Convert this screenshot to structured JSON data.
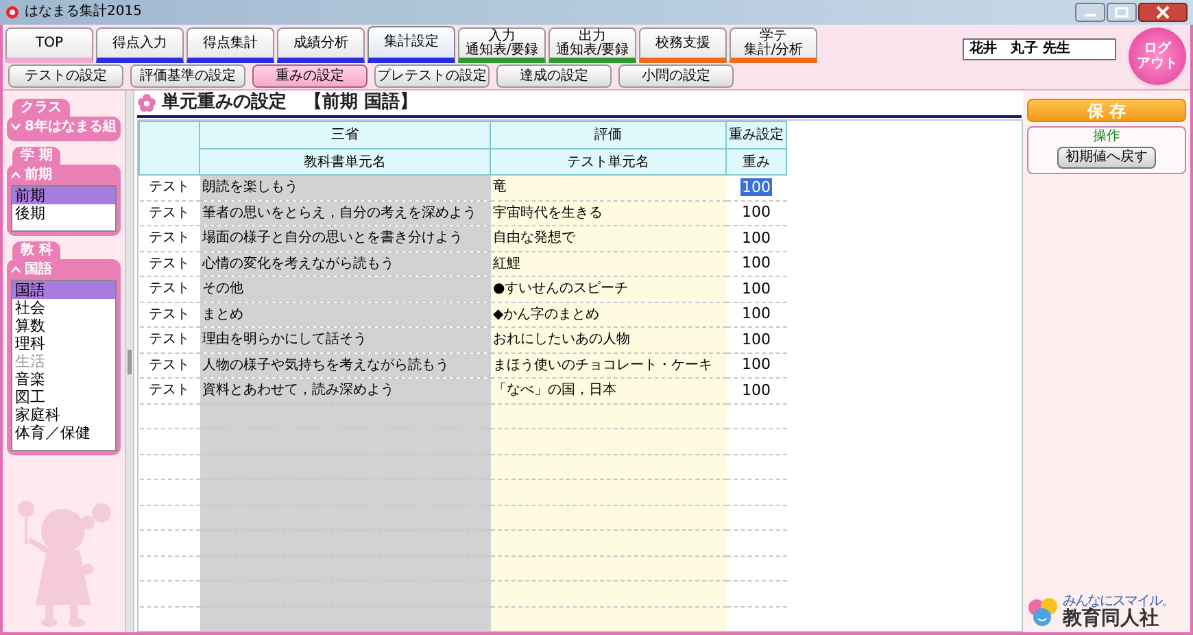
{
  "window": {
    "title": "はなまる集計2015"
  },
  "main_tabs": [
    {
      "label": "TOP",
      "color": "#f7a8cf",
      "selected": false
    },
    {
      "label": "得点入力",
      "color": "#2a2ae0",
      "selected": false
    },
    {
      "label": "得点集計",
      "color": "#2a2ae0",
      "selected": false
    },
    {
      "label": "成績分析",
      "color": "#2a2ae0",
      "selected": false
    },
    {
      "label": "集計設定",
      "color": "#2a2ae0",
      "selected": true
    },
    {
      "lines": [
        "入力",
        "通知表/要録"
      ],
      "color": "#2e9a2e",
      "selected": false
    },
    {
      "lines": [
        "出力",
        "通知表/要録"
      ],
      "color": "#2e9a2e",
      "selected": false
    },
    {
      "label": "校務支援",
      "color": "#f26a1b",
      "selected": false
    },
    {
      "lines": [
        "学テ",
        "集計/分析"
      ],
      "color": "#f26a1b",
      "selected": false
    }
  ],
  "user_name": "花井　丸子 先生",
  "logout_button": [
    "ログ",
    "アウト"
  ],
  "sub_tabs": [
    {
      "label": "テストの設定",
      "selected": false
    },
    {
      "label": "評価基準の設定",
      "selected": false
    },
    {
      "label": "重みの設定",
      "selected": true
    },
    {
      "label": "プレテストの設定",
      "selected": false
    },
    {
      "label": "達成の設定",
      "selected": false
    },
    {
      "label": "小問の設定",
      "selected": false
    }
  ],
  "sidebar": {
    "groups": [
      {
        "title": "クラス",
        "dropdown": "8年はなまる組",
        "expanded": false
      },
      {
        "title": "学 期",
        "dropdown": "前期",
        "expanded": true,
        "items": [
          {
            "label": "前期",
            "selected": true,
            "disabled": false
          },
          {
            "label": "後期",
            "selected": false,
            "disabled": false
          }
        ]
      },
      {
        "title": "教 科",
        "dropdown": "国語",
        "expanded": true,
        "items": [
          {
            "label": "国語",
            "selected": true,
            "disabled": false
          },
          {
            "label": "社会",
            "selected": false,
            "disabled": false
          },
          {
            "label": "算数",
            "selected": false,
            "disabled": false
          },
          {
            "label": "理科",
            "selected": false,
            "disabled": false
          },
          {
            "label": "生活",
            "selected": false,
            "disabled": true
          },
          {
            "label": "音楽",
            "selected": false,
            "disabled": false
          },
          {
            "label": "図工",
            "selected": false,
            "disabled": false
          },
          {
            "label": "家庭科",
            "selected": false,
            "disabled": false
          },
          {
            "label": "体育／保健",
            "selected": false,
            "disabled": false
          }
        ]
      }
    ]
  },
  "page_title": "単元重みの設定　【前期 国語】",
  "table": {
    "columns": [
      {
        "top": "三省",
        "bottom": "教科書単元名"
      },
      {
        "top": "評価",
        "bottom": "テスト単元名"
      },
      {
        "top": "重み設定",
        "bottom": "重み"
      }
    ],
    "rows": [
      {
        "type": "テスト",
        "textbook_unit": "朗読を楽しもう",
        "test_unit": "竜",
        "weight": "100",
        "selected": true
      },
      {
        "type": "テスト",
        "textbook_unit": "筆者の思いをとらえ，自分の考えを深めよう",
        "test_unit": "宇宙時代を生きる",
        "weight": "100",
        "selected": false
      },
      {
        "type": "テスト",
        "textbook_unit": "場面の様子と自分の思いとを書き分けよう",
        "test_unit": "自由な発想で",
        "weight": "100",
        "selected": false
      },
      {
        "type": "テスト",
        "textbook_unit": "心情の変化を考えながら読もう",
        "test_unit": "紅鯉",
        "weight": "100",
        "selected": false
      },
      {
        "type": "テスト",
        "textbook_unit": "その他",
        "test_unit": "●すいせんのスピーチ",
        "weight": "100",
        "selected": false
      },
      {
        "type": "テスト",
        "textbook_unit": "まとめ",
        "test_unit": "◆かん字のまとめ",
        "weight": "100",
        "selected": false
      },
      {
        "type": "テスト",
        "textbook_unit": "理由を明らかにして話そう",
        "test_unit": "おれにしたいあの人物",
        "weight": "100",
        "selected": false
      },
      {
        "type": "テスト",
        "textbook_unit": "人物の様子や気持ちを考えながら読もう",
        "test_unit": "まほう使いのチョコレート・ケーキ",
        "weight": "100",
        "selected": false
      },
      {
        "type": "テスト",
        "textbook_unit": "資料とあわせて，読み深めよう",
        "test_unit": "「なべ」の国，日本",
        "weight": "100",
        "selected": false
      }
    ]
  },
  "save_button": "保 存",
  "operations": {
    "title": "操作",
    "reset_button": "初期値へ戻す"
  },
  "logo": {
    "tagline": "みんなにスマイル。",
    "name": "教育同人社"
  }
}
